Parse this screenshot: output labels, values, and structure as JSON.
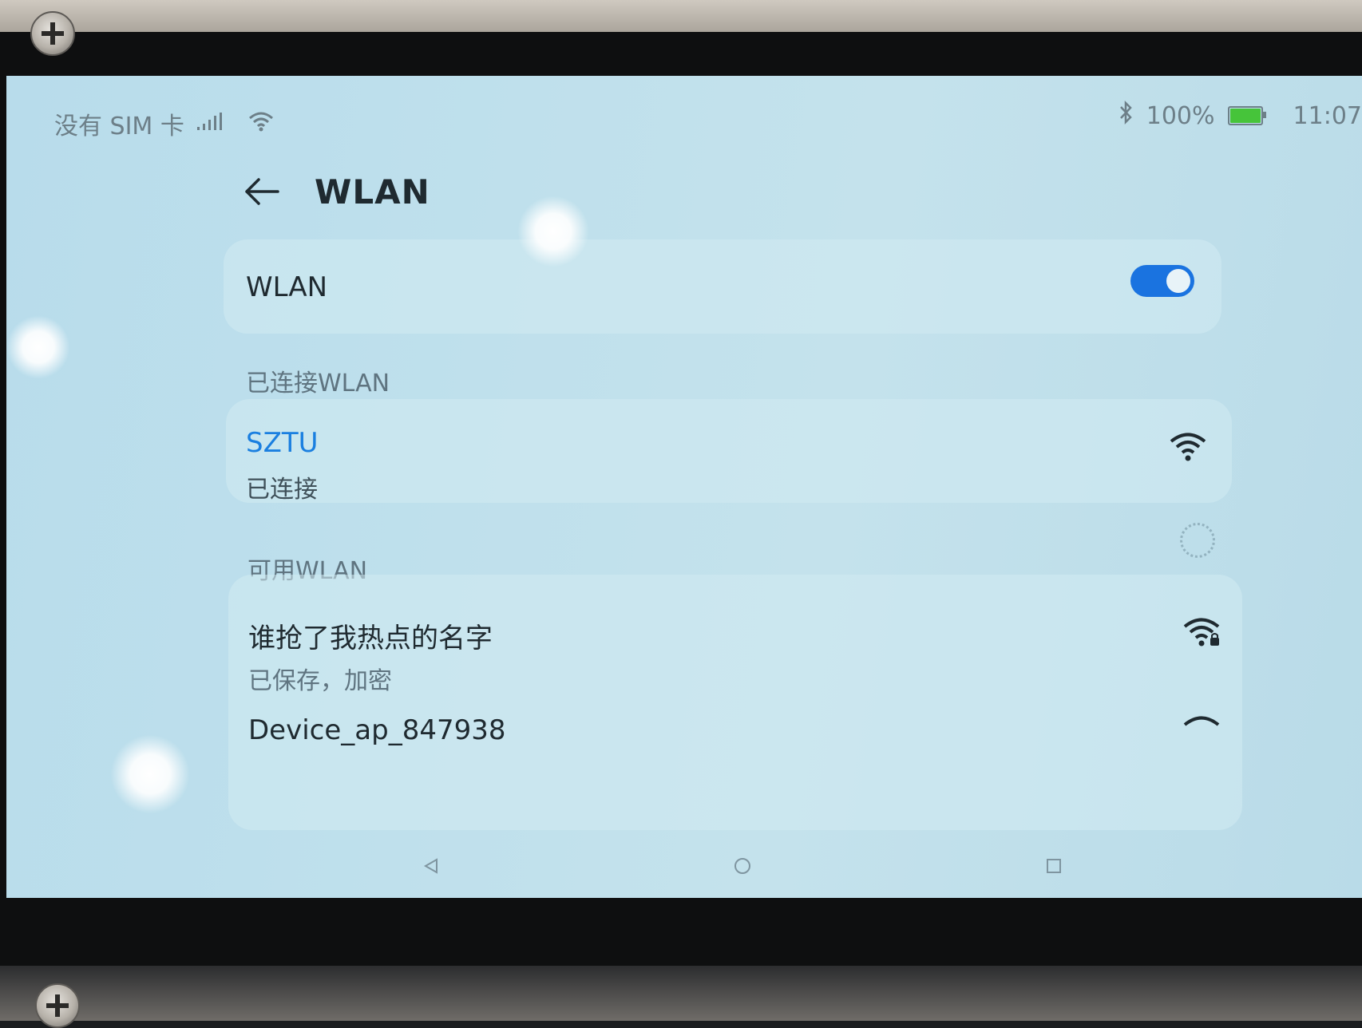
{
  "status_bar": {
    "sim_text": "没有 SIM 卡",
    "battery_percent": "100%",
    "battery_level": 1.0,
    "time": "11:07",
    "icons": [
      "signal-icon",
      "wifi-status-icon",
      "bluetooth-icon",
      "battery-icon"
    ]
  },
  "header": {
    "title": "WLAN",
    "back_icon": "back-arrow-icon"
  },
  "wlan_toggle": {
    "label": "WLAN",
    "enabled": true
  },
  "connected_section": {
    "label": "已连接WLAN",
    "network": {
      "name": "SZTU",
      "status": "已连接"
    }
  },
  "available_section": {
    "label": "可用WLAN",
    "networks": [
      {
        "name": "谁抢了我热点的名字",
        "status": "已保存，加密",
        "secured": true
      },
      {
        "name": "Device_ap_847938",
        "status": "",
        "secured": false
      }
    ]
  },
  "nav_bar": {
    "buttons": [
      "back-triangle-icon",
      "home-circle-icon",
      "recents-square-icon"
    ]
  },
  "colors": {
    "accent": "#1a73e0",
    "connected_name": "#1a7fe0",
    "battery": "#46c43a",
    "screen_bg": "#bfe0ec"
  }
}
